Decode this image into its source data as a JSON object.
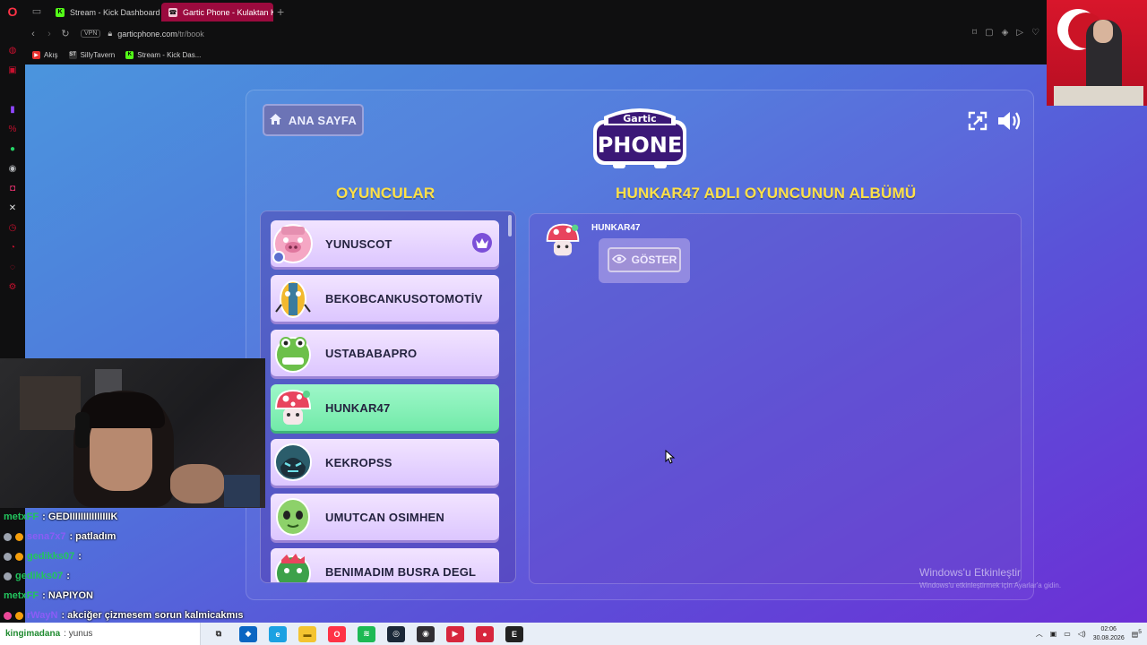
{
  "browser": {
    "tabs": [
      {
        "label": "Stream - Kick Dashboard",
        "active": false
      },
      {
        "label": "Gartic Phone - Kulaktan Ku",
        "active": true
      }
    ],
    "url_domain": "garticphone.com",
    "url_path": "/tr/book",
    "vpn_label": "VPN",
    "bookmarks": [
      "Akış",
      "SillyTavern",
      "Stream - Kick Das..."
    ]
  },
  "game": {
    "home_label": "ANA SAYFA",
    "logo_top": "Gartic",
    "logo_bottom": "PHONE",
    "players_title": "OYUNCULAR",
    "album_title": "HUNKAR47 ADLI OYUNCUNUN ALBÜMÜ",
    "players": [
      {
        "name": "YUNUSCOT",
        "owner": true,
        "selected": false
      },
      {
        "name": "BEKOBCANKUSOTOMOTİV",
        "owner": false,
        "selected": false
      },
      {
        "name": "USTABABAPRO",
        "owner": false,
        "selected": false
      },
      {
        "name": "HUNKAR47",
        "owner": false,
        "selected": true
      },
      {
        "name": "KEKROPSS",
        "owner": false,
        "selected": false
      },
      {
        "name": "UMUTCAN OSIMHEN",
        "owner": false,
        "selected": false
      },
      {
        "name": "BENIMADIM BUSRA DEGL",
        "owner": false,
        "selected": false
      }
    ],
    "album": {
      "author": "HUNKAR47",
      "show_label": "GÖSTER"
    }
  },
  "windows": {
    "activate_title": "Windows'u Etkinleştir",
    "activate_sub": "Windows'u etkinleştirmek için Ayarlar'a gidin."
  },
  "chat": [
    {
      "user": "metxFF",
      "msg": ": GEDIIIIIIIIIIIIIIIK",
      "color": "#22c55e"
    },
    {
      "user": "sena7x7",
      "msg": ": patladım",
      "color": "#8b5cf6"
    },
    {
      "user": "gedikks07",
      "msg": ":",
      "color": "#22c55e"
    },
    {
      "user": "gedikks07",
      "msg": ":",
      "color": "#22c55e"
    },
    {
      "user": "metxFF",
      "msg": ": NAPIYON",
      "color": "#22c55e"
    },
    {
      "user": "rWayN",
      "msg": ": akciğer çizmesem sorun kalmicakmıs",
      "color": "#8b5cf6"
    }
  ],
  "taskbar": {
    "search_user": "kingimadana",
    "search_text": ": yunus",
    "time": "02:06",
    "date": "30.08.2026",
    "notif_count": "5"
  },
  "colors": {
    "accent_yellow": "#fde047",
    "selected_green": "#72eaa9",
    "opera_red": "#ff3346"
  }
}
